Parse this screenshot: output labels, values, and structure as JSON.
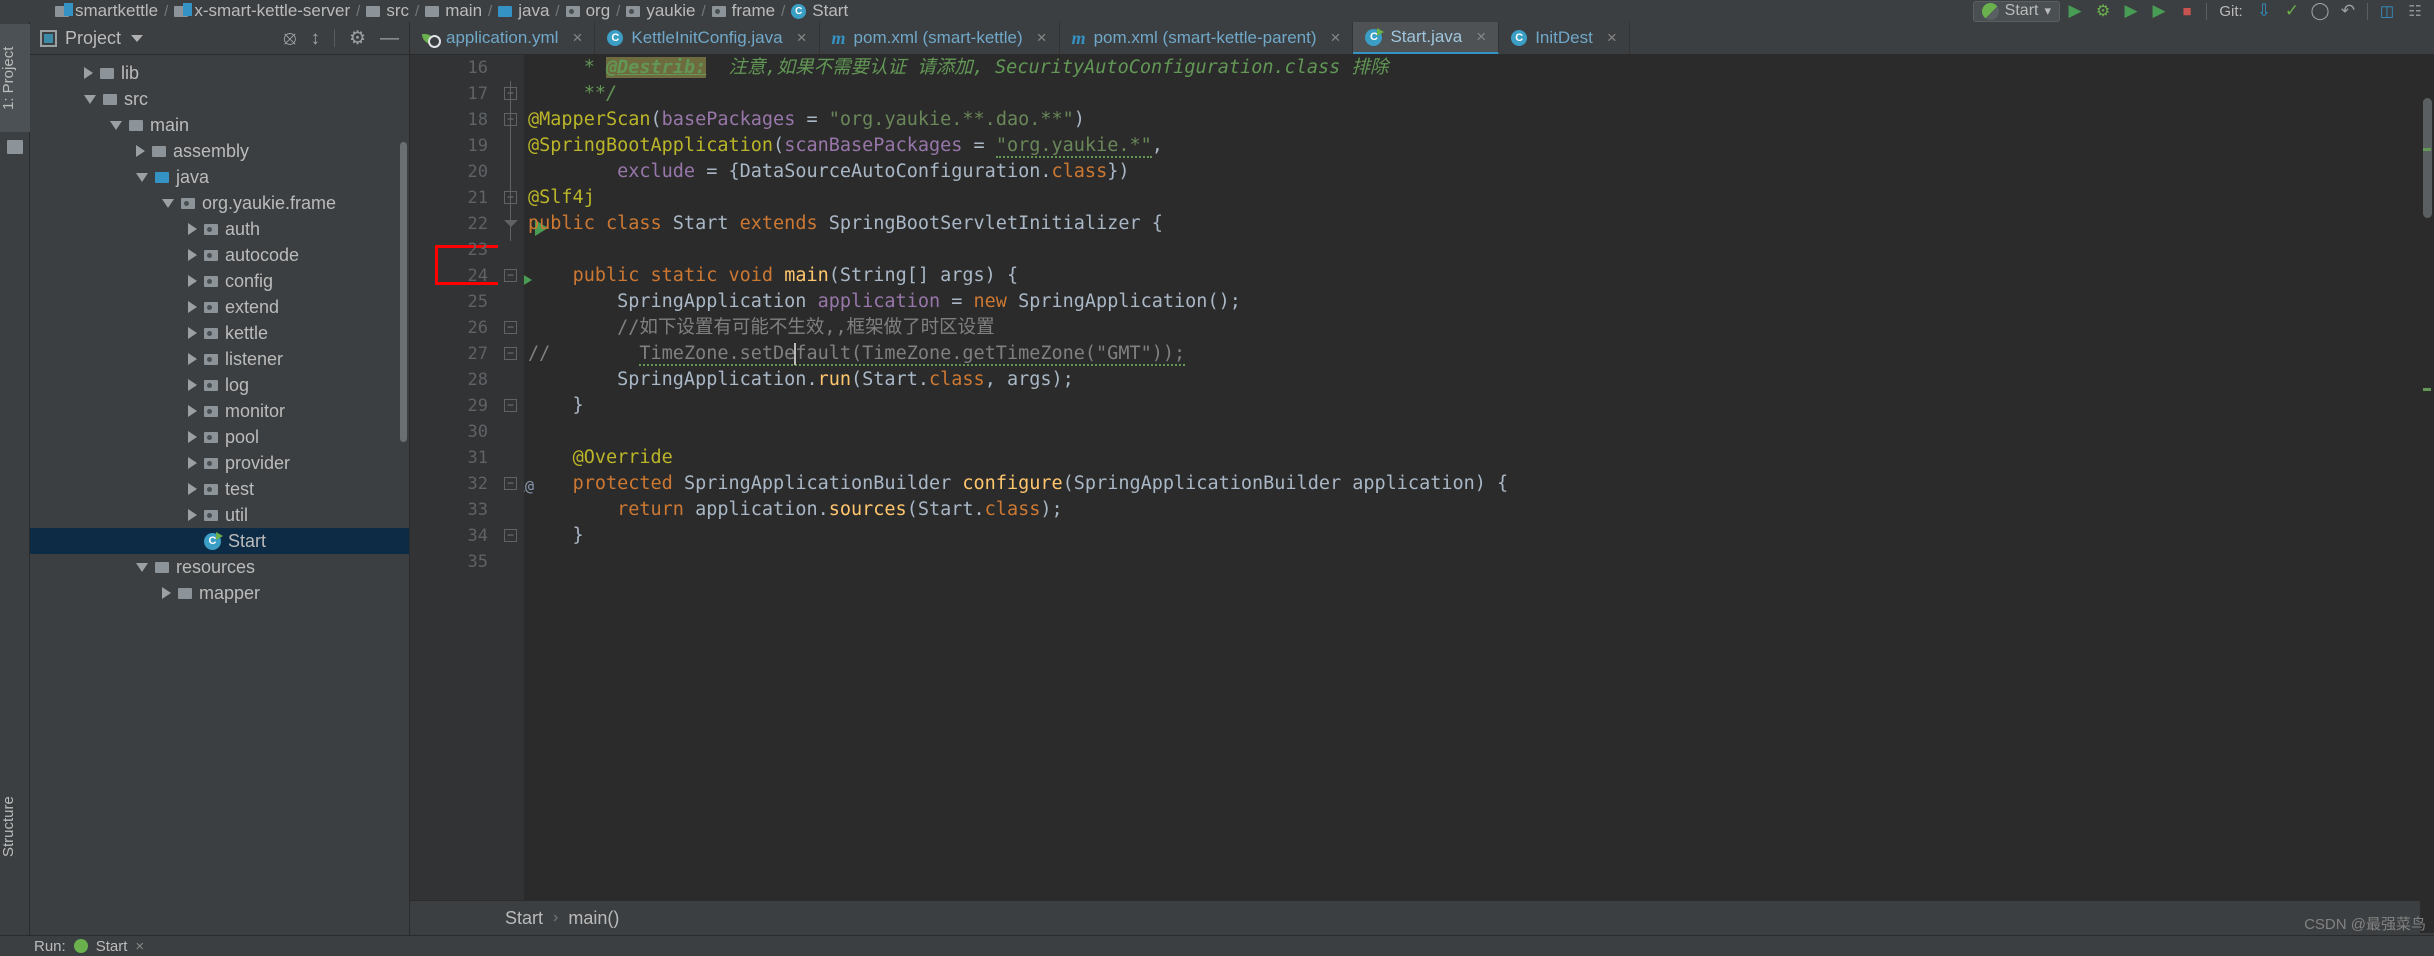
{
  "window": {
    "breadcrumb": [
      {
        "label": "smartkettle",
        "icon": "module-folder-icon"
      },
      {
        "label": "x-smart-kettle-server",
        "icon": "module-folder-icon"
      },
      {
        "label": "src",
        "icon": "folder-icon"
      },
      {
        "label": "main",
        "icon": "folder-icon"
      },
      {
        "label": "java",
        "icon": "source-folder-icon"
      },
      {
        "label": "org",
        "icon": "package-icon"
      },
      {
        "label": "yaukie",
        "icon": "package-icon"
      },
      {
        "label": "frame",
        "icon": "package-icon"
      },
      {
        "label": "Start",
        "icon": "spring-class-icon"
      }
    ],
    "run_config": {
      "label": "Start",
      "icon": "spring-boot-icon",
      "dropdown": "▾"
    },
    "toolbar_buttons": [
      {
        "name": "run-button",
        "glyph": "▶"
      },
      {
        "name": "debug-button",
        "glyph": "ὁe"
      },
      {
        "name": "run-with-coverage-button",
        "glyph": "▶"
      },
      {
        "name": "profile-button",
        "glyph": "▶"
      },
      {
        "name": "stop-button",
        "glyph": "■"
      },
      {
        "name": "git-label",
        "glyph": "Git:"
      },
      {
        "name": "update-project-button",
        "glyph": "↓"
      },
      {
        "name": "commit-button",
        "glyph": "✓"
      },
      {
        "name": "push-button",
        "glyph": "↑"
      },
      {
        "name": "history-button",
        "glyph": "↺"
      },
      {
        "name": "undo-button",
        "glyph": "↶"
      },
      {
        "name": "database-button",
        "glyph": "▤"
      },
      {
        "name": "maven-button",
        "glyph": "m"
      }
    ]
  },
  "left_strip": {
    "project_tab": "1: Project",
    "structure_tab": "Structure"
  },
  "project_panel": {
    "title": "Project",
    "header_icons": [
      "locate-icon",
      "collapse-all-icon",
      "settings-icon",
      "hide-icon"
    ],
    "tree": [
      {
        "label": "lib",
        "depth": 1,
        "state": "collapsed",
        "icon": "folder-icon",
        "selected": false
      },
      {
        "label": "src",
        "depth": 1,
        "state": "expanded",
        "icon": "folder-icon",
        "selected": false
      },
      {
        "label": "main",
        "depth": 2,
        "state": "expanded",
        "icon": "folder-icon",
        "selected": false
      },
      {
        "label": "assembly",
        "depth": 3,
        "state": "collapsed",
        "icon": "folder-icon",
        "selected": false
      },
      {
        "label": "java",
        "depth": 3,
        "state": "expanded",
        "icon": "source-folder-icon",
        "selected": false
      },
      {
        "label": "org.yaukie.frame",
        "depth": 4,
        "state": "expanded",
        "icon": "package-icon",
        "selected": false
      },
      {
        "label": "auth",
        "depth": 5,
        "state": "collapsed",
        "icon": "package-icon",
        "selected": false
      },
      {
        "label": "autocode",
        "depth": 5,
        "state": "collapsed",
        "icon": "package-icon",
        "selected": false
      },
      {
        "label": "config",
        "depth": 5,
        "state": "collapsed",
        "icon": "package-icon",
        "selected": false
      },
      {
        "label": "extend",
        "depth": 5,
        "state": "collapsed",
        "icon": "package-icon",
        "selected": false
      },
      {
        "label": "kettle",
        "depth": 5,
        "state": "collapsed",
        "icon": "package-icon",
        "selected": false
      },
      {
        "label": "listener",
        "depth": 5,
        "state": "collapsed",
        "icon": "package-icon",
        "selected": false
      },
      {
        "label": "log",
        "depth": 5,
        "state": "collapsed",
        "icon": "package-icon",
        "selected": false
      },
      {
        "label": "monitor",
        "depth": 5,
        "state": "collapsed",
        "icon": "package-icon",
        "selected": false
      },
      {
        "label": "pool",
        "depth": 5,
        "state": "collapsed",
        "icon": "package-icon",
        "selected": false
      },
      {
        "label": "provider",
        "depth": 5,
        "state": "collapsed",
        "icon": "package-icon",
        "selected": false
      },
      {
        "label": "test",
        "depth": 5,
        "state": "collapsed",
        "icon": "package-icon",
        "selected": false
      },
      {
        "label": "util",
        "depth": 5,
        "state": "collapsed",
        "icon": "package-icon",
        "selected": false
      },
      {
        "label": "Start",
        "depth": 5,
        "state": "leaf",
        "icon": "spring-class-icon",
        "selected": true
      },
      {
        "label": "resources",
        "depth": 3,
        "state": "expanded",
        "icon": "resource-folder-icon",
        "selected": false
      },
      {
        "label": "mapper",
        "depth": 4,
        "state": "collapsed",
        "icon": "folder-icon",
        "selected": false
      }
    ]
  },
  "editor": {
    "tabs": [
      {
        "label": "application.yml",
        "icon": "yaml-icon",
        "active": false,
        "close": "×"
      },
      {
        "label": "KettleInitConfig.java",
        "icon": "class-icon",
        "active": false,
        "close": "×"
      },
      {
        "label": "pom.xml (smart-kettle)",
        "icon": "maven-icon",
        "active": false,
        "close": "×"
      },
      {
        "label": "pom.xml (smart-kettle-parent)",
        "icon": "maven-icon",
        "active": false,
        "close": "×"
      },
      {
        "label": "Start.java",
        "icon": "spring-class-icon",
        "active": true,
        "close": "×"
      },
      {
        "label": "InitDest",
        "icon": "class-icon",
        "active": false,
        "close": "×"
      }
    ],
    "first_line_number": 16,
    "lines": [
      {
        "n": 16,
        "gutter_icon": null,
        "fold": null,
        "html": "<span class='cmtg'>     * </span><span class='hl-todo'>@Destrib:</span><span class='cmtg'>  注意,如果不需要认证 请添加, SecurityAutoConfiguration.class 排除</span>"
      },
      {
        "n": 17,
        "gutter_icon": null,
        "fold": "end",
        "html": "<span class='cmtg'>     **/</span>"
      },
      {
        "n": 18,
        "gutter_icon": null,
        "fold": "start",
        "html": "<span class='ann'>@MapperScan</span><span class='plain'>(</span><span class='fld'>basePackages </span><span class='plain'>= </span><span class='str'>\"org.yaukie.**.dao.**\"</span><span class='plain'>)</span>"
      },
      {
        "n": 19,
        "gutter_icon": "spring-bean-icon",
        "fold": null,
        "html": "<span class='ann'>@SpringBootApplication</span><span class='plain'>(</span><span class='fld'>scanBasePackages </span><span class='plain'>= </span><span class='str squiggle'>\"org.yaukie.*\"</span><span class='plain'>,</span>"
      },
      {
        "n": 20,
        "gutter_icon": null,
        "fold": null,
        "html": "<span class='plain'>        </span><span class='fld'>exclude </span><span class='plain'>= {</span><span class='cls'>DataSourceAutoConfiguration.</span><span class='kw'>class</span><span class='plain'>})</span>"
      },
      {
        "n": 21,
        "gutter_icon": null,
        "fold": "mark",
        "html": "<span class='ann'>@Slf4j</span>"
      },
      {
        "n": 22,
        "gutter_icon": "spring-run-icons",
        "fold": "v",
        "html": "<span class='kw'>public class </span><span class='plain'>Start </span><span class='kw'>extends </span><span class='plain'>SpringBootServletInitializer {</span>"
      },
      {
        "n": 23,
        "gutter_icon": null,
        "fold": null,
        "html": ""
      },
      {
        "n": 24,
        "gutter_icon": "run-icon",
        "fold": "mark",
        "html": "<span class='plain'>    </span><span class='kw'>public static void </span><span class='mth'>main</span><span class='plain'>(String[] args) {</span>"
      },
      {
        "n": 25,
        "gutter_icon": null,
        "fold": null,
        "html": "<span class='plain'>        SpringApplication </span><span class='fld'>application </span><span class='plain'>= </span><span class='kw'>new </span><span class='plain'>SpringApplication();</span>"
      },
      {
        "n": 26,
        "gutter_icon": null,
        "fold": "mark",
        "html": "<span class='plain'>        </span><span class='cmt'>//如下设置有可能不生效,,框架做了时区设置</span>"
      },
      {
        "n": 27,
        "gutter_icon": null,
        "fold": "mark",
        "html": "<span class='cmt'>//        </span><span class='cmt squiggle'>TimeZone.setDefault(TimeZone.getTimeZone(\"GMT\"));</span>"
      },
      {
        "n": 28,
        "gutter_icon": null,
        "fold": null,
        "html": "<span class='plain'>        SpringApplication.</span><span class='mth'>run</span><span class='plain'>(Start.</span><span class='kw'>class</span><span class='plain'>, args);</span>"
      },
      {
        "n": 29,
        "gutter_icon": null,
        "fold": "mark",
        "html": "<span class='plain'>    }</span>"
      },
      {
        "n": 30,
        "gutter_icon": null,
        "fold": null,
        "html": ""
      },
      {
        "n": 31,
        "gutter_icon": null,
        "fold": null,
        "html": "<span class='plain'>    </span><span class='ann'>@Override</span>"
      },
      {
        "n": 32,
        "gutter_icon": "override-icon",
        "fold": "mark",
        "html": "<span class='plain'>    </span><span class='kw'>protected </span><span class='plain'>SpringApplicationBuilder </span><span class='mth'>configure</span><span class='plain'>(SpringApplicationBuilder application) {</span>"
      },
      {
        "n": 33,
        "gutter_icon": null,
        "fold": null,
        "html": "<span class='plain'>        </span><span class='kw'>return </span><span class='plain'>application.</span><span class='mth'>sources</span><span class='plain'>(Start.</span><span class='kw'>class</span><span class='plain'>);</span>"
      },
      {
        "n": 34,
        "gutter_icon": null,
        "fold": "mark",
        "html": "<span class='plain'>    }</span>"
      },
      {
        "n": 35,
        "gutter_icon": null,
        "fold": null,
        "html": ""
      }
    ],
    "breadcrumb": {
      "class_name": "Start",
      "separator": "›",
      "method_name": "main()"
    }
  },
  "bottom": {
    "run_tab": "Start",
    "run_label": "Run:",
    "close": "×"
  },
  "watermark": "CSDN @最强菜鸟",
  "colors": {
    "accent_blue": "#3592c4",
    "selection": "#0d2b45",
    "editor_bg": "#2b2b2b",
    "panel_bg": "#3c3f41",
    "gutter_bg": "#313335",
    "annotation_red": "#ff0000",
    "keyword": "#cc7832",
    "string": "#6a8759",
    "annotation_yellow": "#bbb529",
    "field": "#9876aa",
    "method": "#ffc66d",
    "comment": "#808080",
    "javadoc": "#629755"
  }
}
